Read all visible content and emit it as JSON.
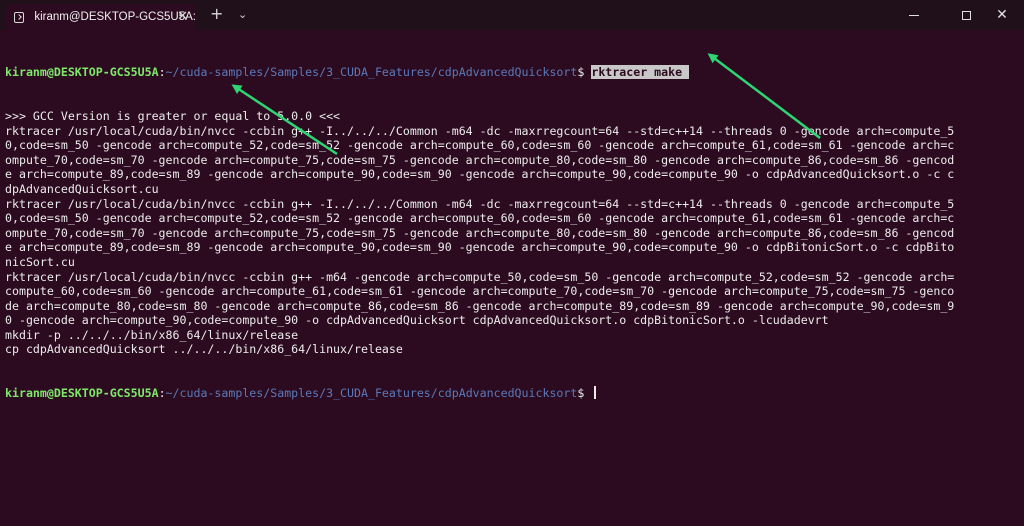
{
  "titlebar": {
    "tab_title": "kiranm@DESKTOP-GCS5U5A:",
    "tab_icon": "terminal-icon",
    "close_tab_glyph": "✕",
    "new_tab_glyph": "+",
    "dropdown_glyph": "⌄",
    "close_window_glyph": "✕"
  },
  "colors": {
    "background": "#2c0b20",
    "prompt_user": "#7ee86a",
    "prompt_path": "#5b79b8",
    "arrow": "#2ed573"
  },
  "terminal": {
    "prompt1": {
      "user": "kiranm@DESKTOP-GCS5U5A",
      "sep": ":",
      "path": "~/cuda-samples/Samples/3_CUDA_Features/cdpAdvancedQuicksort",
      "symbol": "$ ",
      "command": "rktracer make "
    },
    "output": [
      ">>> GCC Version is greater or equal to 5.0.0 <<<",
      "rktracer /usr/local/cuda/bin/nvcc -ccbin g++ -I../../../Common -m64 -dc -maxrregcount=64 --std=c++14 --threads 0 -gencode arch=compute_5",
      "0,code=sm_50 -gencode arch=compute_52,code=sm_52 -gencode arch=compute_60,code=sm_60 -gencode arch=compute_61,code=sm_61 -gencode arch=c",
      "ompute_70,code=sm_70 -gencode arch=compute_75,code=sm_75 -gencode arch=compute_80,code=sm_80 -gencode arch=compute_86,code=sm_86 -gencod",
      "e arch=compute_89,code=sm_89 -gencode arch=compute_90,code=sm_90 -gencode arch=compute_90,code=compute_90 -o cdpAdvancedQuicksort.o -c c",
      "dpAdvancedQuicksort.cu",
      "rktracer /usr/local/cuda/bin/nvcc -ccbin g++ -I../../../Common -m64 -dc -maxrregcount=64 --std=c++14 --threads 0 -gencode arch=compute_5",
      "0,code=sm_50 -gencode arch=compute_52,code=sm_52 -gencode arch=compute_60,code=sm_60 -gencode arch=compute_61,code=sm_61 -gencode arch=c",
      "ompute_70,code=sm_70 -gencode arch=compute_75,code=sm_75 -gencode arch=compute_80,code=sm_80 -gencode arch=compute_86,code=sm_86 -gencod",
      "e arch=compute_89,code=sm_89 -gencode arch=compute_90,code=sm_90 -gencode arch=compute_90,code=compute_90 -o cdpBitonicSort.o -c cdpBito",
      "nicSort.cu",
      "rktracer /usr/local/cuda/bin/nvcc -ccbin g++ -m64 -gencode arch=compute_50,code=sm_50 -gencode arch=compute_52,code=sm_52 -gencode arch=",
      "compute_60,code=sm_60 -gencode arch=compute_61,code=sm_61 -gencode arch=compute_70,code=sm_70 -gencode arch=compute_75,code=sm_75 -genco",
      "de arch=compute_80,code=sm_80 -gencode arch=compute_86,code=sm_86 -gencode arch=compute_89,code=sm_89 -gencode arch=compute_90,code=sm_9",
      "0 -gencode arch=compute_90,code=compute_90 -o cdpAdvancedQuicksort cdpAdvancedQuicksort.o cdpBitonicSort.o -lcudadevrt",
      "mkdir -p ../../../bin/x86_64/linux/release",
      "cp cdpAdvancedQuicksort ../../../bin/x86_64/linux/release"
    ],
    "prompt2": {
      "user": "kiranm@DESKTOP-GCS5U5A",
      "sep": ":",
      "path": "~/cuda-samples/Samples/3_CUDA_Features/cdpAdvancedQuicksort",
      "symbol": "$ "
    }
  }
}
